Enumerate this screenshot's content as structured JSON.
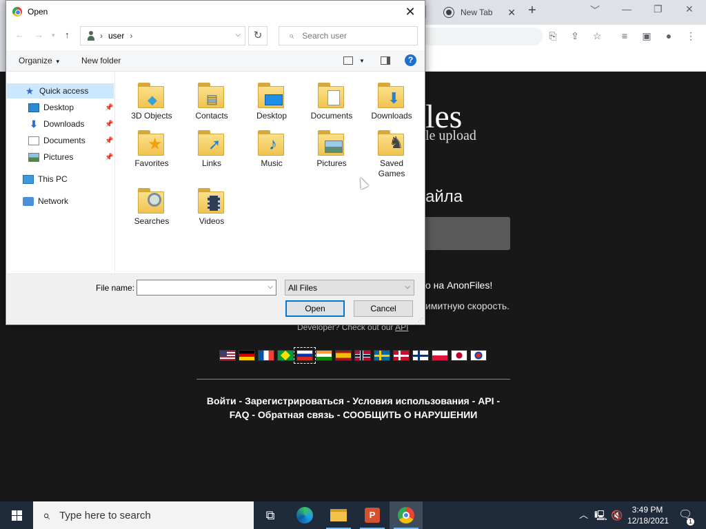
{
  "browser": {
    "tab_title": "New Tab",
    "tab_close": "✕",
    "new_tab": "+",
    "window_controls": [
      "﹀",
      "—",
      "❐",
      "✕"
    ]
  },
  "website": {
    "logo_text": "les",
    "logo_sub": "le upload",
    "heading": "айла",
    "line1": "о на AnonFiles!",
    "line2": "имитную скорость.",
    "dev_prefix": "Developer? Check out our ",
    "dev_link": "API",
    "flags": [
      "us",
      "de",
      "fr",
      "br",
      "ru",
      "in",
      "es",
      "no",
      "se",
      "dk",
      "fi",
      "pl",
      "jp",
      "kr"
    ],
    "selected_flag": "ru",
    "footer_line1": [
      "Войти",
      "Зарегистрироваться",
      "Условия использования",
      "API"
    ],
    "footer_line2": [
      "FAQ",
      "Обратная связь",
      "СООБЩИТЬ О НАРУШЕНИИ"
    ],
    "footer_sep": " - "
  },
  "dialog": {
    "title": "Open",
    "close": "✕",
    "path_segment": "user",
    "search_placeholder": "Search user",
    "organize": "Organize",
    "new_folder": "New folder",
    "help": "?",
    "nav": {
      "quick_access": "Quick access",
      "desktop": "Desktop",
      "downloads": "Downloads",
      "documents": "Documents",
      "pictures": "Pictures",
      "this_pc": "This PC",
      "network": "Network"
    },
    "folders": [
      {
        "label": "3D Objects",
        "icon": "cube"
      },
      {
        "label": "Contacts",
        "icon": "contact-card"
      },
      {
        "label": "Desktop",
        "icon": "monitor"
      },
      {
        "label": "Documents",
        "icon": "document"
      },
      {
        "label": "Downloads",
        "icon": "down-arrow"
      },
      {
        "label": "Favorites",
        "icon": "star"
      },
      {
        "label": "Links",
        "icon": "arrow-link"
      },
      {
        "label": "Music",
        "icon": "music-note"
      },
      {
        "label": "Pictures",
        "icon": "landscape"
      },
      {
        "label": "Saved Games",
        "icon": "chess-piece"
      },
      {
        "label": "Searches",
        "icon": "magnifier"
      },
      {
        "label": "Videos",
        "icon": "film"
      }
    ],
    "file_name_label": "File name:",
    "file_name_value": "",
    "file_type": "All Files",
    "open_button": "Open",
    "cancel_button": "Cancel"
  },
  "taskbar": {
    "search_placeholder": "Type here to search",
    "time": "3:49 PM",
    "date": "12/18/2021",
    "notification_count": "1"
  }
}
